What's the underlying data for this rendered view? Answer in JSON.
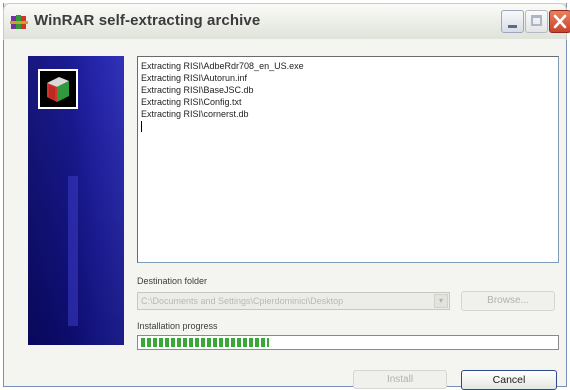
{
  "window": {
    "title": "WinRAR self-extracting archive",
    "icons": {
      "app": "winrar-books-icon",
      "minimize": "minimize-icon",
      "maximize": "maximize-icon",
      "close": "close-icon"
    }
  },
  "banner": {
    "icon": "winrar-archive-book-icon"
  },
  "log": {
    "lines": [
      "Extracting RISI\\AdbeRdr708_en_US.exe",
      "Extracting RISI\\Autorun.inf",
      "Extracting RISI\\BaseJSC.db",
      "Extracting RISI\\Config.txt",
      "Extracting RISI\\cornerst.db"
    ]
  },
  "destination": {
    "label": "Destination folder",
    "value": "C:\\Documents and Settings\\Cpierdominici\\Desktop",
    "browse_label": "Browse..."
  },
  "progress": {
    "label": "Installation progress",
    "fraction": 0.31
  },
  "footer": {
    "install_label": "Install",
    "cancel_label": "Cancel"
  },
  "colors": {
    "banner": "#10108f",
    "progress": "#39a839",
    "close_button": "#c9422c"
  }
}
